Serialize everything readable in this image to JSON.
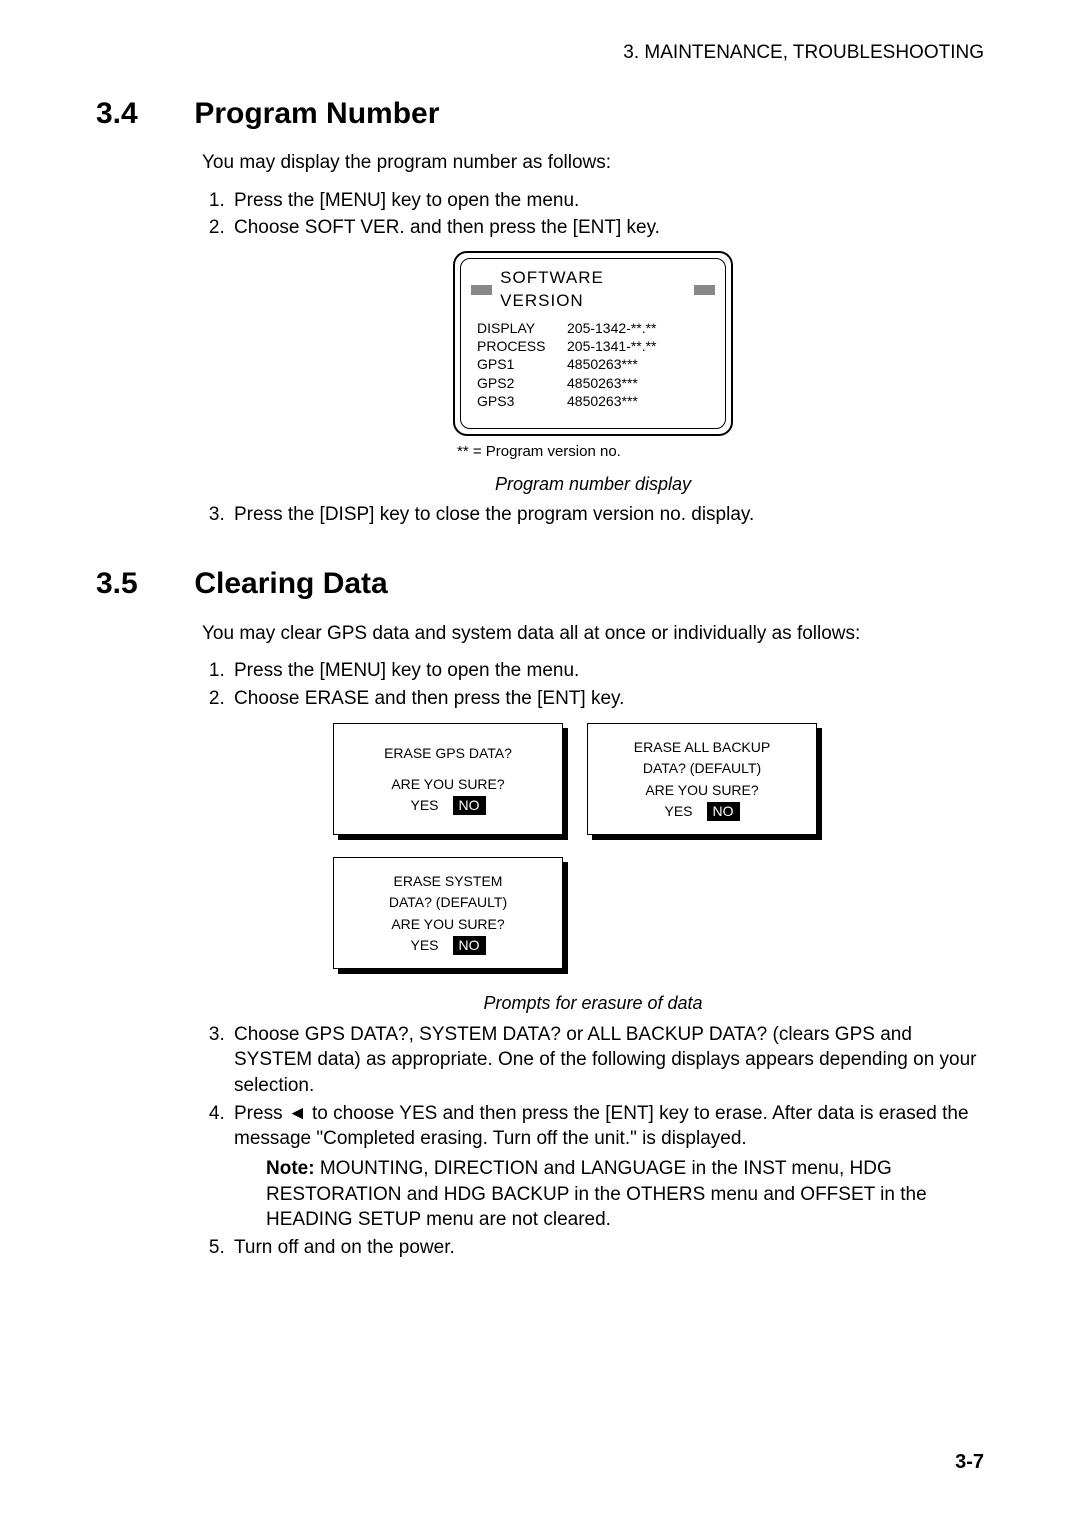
{
  "header": {
    "running": "3. MAINTENANCE, TROUBLESHOOTING"
  },
  "sec34": {
    "num": "3.4",
    "title": "Program Number",
    "intro": "You may display the program number as follows:",
    "steps": [
      "Press the [MENU] key to open the menu.",
      "Choose SOFT VER. and then press the [ENT] key."
    ],
    "swv": {
      "title": "SOFTWARE VERSION",
      "rows": [
        {
          "label": "DISPLAY",
          "value": "205-1342-**.**"
        },
        {
          "label": "PROCESS",
          "value": "205-1341-**.**"
        },
        {
          "label": "GPS1",
          "value": "4850263***"
        },
        {
          "label": "GPS2",
          "value": "4850263***"
        },
        {
          "label": "GPS3",
          "value": "4850263***"
        }
      ],
      "footnote": "** = Program version no."
    },
    "caption": "Program number display",
    "step3": "Press the [DISP] key to close the program version no. display."
  },
  "sec35": {
    "num": "3.5",
    "title": "Clearing Data",
    "intro": "You may clear GPS data and system data all at once or individually as follows:",
    "steps12": [
      "Press the [MENU] key to open the menu.",
      "Choose ERASE and then press the [ENT] key."
    ],
    "prompts": {
      "gps": {
        "l1": "ERASE GPS DATA?",
        "l2": "",
        "q": "ARE YOU SURE?",
        "yes": "YES",
        "no": "NO"
      },
      "all": {
        "l1": "ERASE ALL BACKUP",
        "l2": "DATA? (DEFAULT)",
        "q": "ARE YOU SURE?",
        "yes": "YES",
        "no": "NO"
      },
      "system": {
        "l1": "ERASE SYSTEM",
        "l2": "DATA? (DEFAULT)",
        "q": "ARE YOU SURE?",
        "yes": "YES",
        "no": "NO"
      }
    },
    "caption": "Prompts for erasure of data",
    "step3": "Choose GPS DATA?, SYSTEM DATA? or ALL BACKUP DATA? (clears GPS and SYSTEM data) as appropriate. One of the following displays appears depending on your selection.",
    "step4_a": "Press ",
    "step4_arrow": "◄",
    "step4_b": " to choose YES and then press the [ENT] key to erase. After data is erased the message \"Completed erasing. Turn off the unit.\" is displayed.",
    "note_label": "Note:",
    "note_body": " MOUNTING, DIRECTION and LANGUAGE in the INST menu, HDG RESTORATION and HDG BACKUP in the OTHERS menu and OFFSET in the HEADING SETUP menu are not cleared.",
    "step5": "Turn off and on the power."
  },
  "page_number": "3-7"
}
